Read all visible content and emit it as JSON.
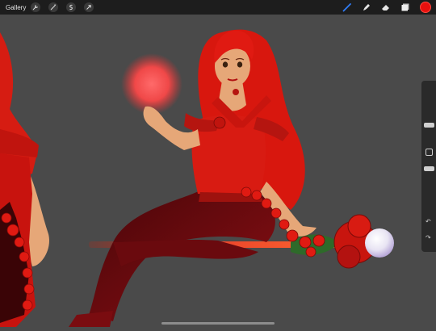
{
  "topbar": {
    "gallery_label": "Gallery",
    "left_tools": [
      "wrench-icon",
      "magic-wand-icon",
      "selection-icon",
      "transform-arrow-icon"
    ],
    "right_tools": [
      "brush-icon",
      "smudge-icon",
      "eraser-icon",
      "layers-icon"
    ],
    "active_color": "#e8100e"
  },
  "colors": {
    "canvas_bg": "#4a4a4a",
    "topbar_bg": "#1d1d1d",
    "accent": "#2f7cf6"
  }
}
